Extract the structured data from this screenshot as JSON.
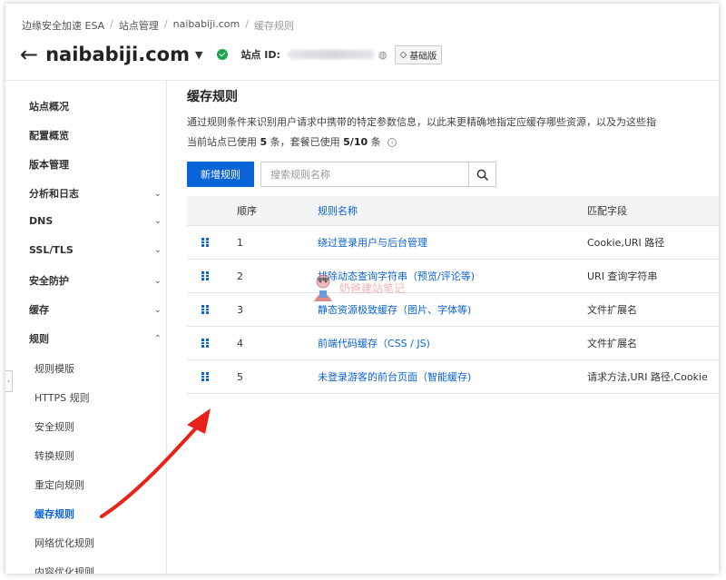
{
  "breadcrumb": [
    "边缘安全加速 ESA",
    "站点管理",
    "naibabiji.com",
    "缓存规则"
  ],
  "header": {
    "site_name": "naibabiji.com",
    "site_id_label": "站点 ID:",
    "plan_badge": "基础版"
  },
  "sidebar": {
    "items": [
      {
        "label": "站点概况"
      },
      {
        "label": "配置概览"
      },
      {
        "label": "版本管理"
      },
      {
        "label": "分析和日志",
        "chevron": "down"
      },
      {
        "label": "DNS",
        "chevron": "down"
      },
      {
        "label": "SSL/TLS",
        "chevron": "down"
      },
      {
        "label": "安全防护",
        "chevron": "down"
      },
      {
        "label": "缓存",
        "chevron": "down"
      },
      {
        "label": "规则",
        "chevron": "up"
      }
    ],
    "sub_items": [
      {
        "label": "规则模版"
      },
      {
        "label": "HTTPS 规则"
      },
      {
        "label": "安全规则"
      },
      {
        "label": "转换规则"
      },
      {
        "label": "重定向规则"
      },
      {
        "label": "缓存规则",
        "active": true
      },
      {
        "label": "网络优化规则"
      },
      {
        "label": "内容优化规则"
      }
    ]
  },
  "main": {
    "title": "缓存规则",
    "description": "通过规则条件来识别用户请求中携带的特定参数信息，以此来更精确地指定应缓存哪些资源，以及为这些指",
    "usage": {
      "prefix": "当前站点已使用",
      "site_count": "5",
      "mid": "条，套餐已使用",
      "plan_count": "5/10",
      "suffix": "条"
    },
    "new_rule_label": "新增规则",
    "search_placeholder": "搜索规则名称",
    "table": {
      "headers": {
        "order": "顺序",
        "name": "规则名称",
        "field": "匹配字段"
      },
      "rows": [
        {
          "order": "1",
          "name": "绕过登录用户与后台管理",
          "field": "Cookie,URI 路径"
        },
        {
          "order": "2",
          "name": "排除动态查询字符串（预览/评论等)",
          "field": "URI 查询字符串"
        },
        {
          "order": "3",
          "name": "静态资源极致缓存（图片、字体等)",
          "field": "文件扩展名"
        },
        {
          "order": "4",
          "name": "前端代码缓存（CSS / JS)",
          "field": "文件扩展名"
        },
        {
          "order": "5",
          "name": "未登录游客的前台页面（智能缓存)",
          "field": "请求方法,URI 路径,Cookie"
        }
      ]
    }
  },
  "watermark": {
    "text": "奶爸建站笔记"
  },
  "colors": {
    "accent": "#0a63d8",
    "success": "#1aa34a",
    "annotation": "#e8221b"
  }
}
